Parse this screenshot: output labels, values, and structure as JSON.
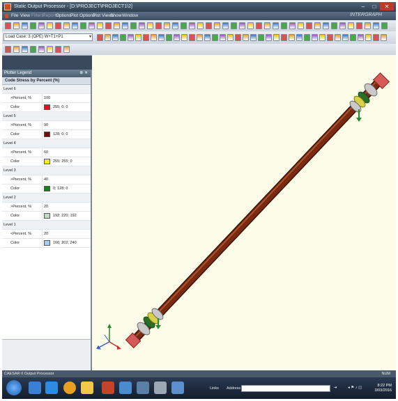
{
  "window": {
    "title": "Static Output Processor - [D:\\PROJECT\\PROJECT1\\2]",
    "brand": "INTERGRAPH",
    "controls": [
      "minimize",
      "maximize",
      "close"
    ]
  },
  "menu": [
    "File",
    "View",
    "Filters",
    "Reports",
    "Options",
    "Plot Options",
    "Plot Views",
    "Show",
    "Window"
  ],
  "menu_dim": [
    false,
    false,
    true,
    true,
    false,
    false,
    false,
    false,
    false
  ],
  "toolbar": {
    "load_case": "Load Case: 3 (OPE) W+T1+P1",
    "colors": [
      "#d9534f",
      "#e0a030",
      "#3b78c2",
      "#4aa84a",
      "#9b59b6",
      "#f1c40f"
    ]
  },
  "legend": {
    "header": "Plotter Legend",
    "subheader": "Code Stress by Percent (%)",
    "levels": [
      {
        "level": "Level 6",
        "cmp_label": ">Percent, %",
        "cmp_value": "100",
        "color_label": "Color",
        "color_value": "255; 0; 0",
        "hex": "#cc1f1f"
      },
      {
        "level": "Level 5",
        "cmp_label": ">Percent, %",
        "cmp_value": "90",
        "color_label": "Color",
        "color_value": "128; 0; 0",
        "hex": "#7a0a0a"
      },
      {
        "level": "Level 4",
        "cmp_label": ">Percent, %",
        "cmp_value": "60",
        "color_label": "Color",
        "color_value": "255; 255; 0",
        "hex": "#f3ee12"
      },
      {
        "level": "Level 3",
        "cmp_label": ">Percent, %",
        "cmp_value": "40",
        "color_label": "Color",
        "color_value": "0; 128; 0",
        "hex": "#1a7f1a"
      },
      {
        "level": "Level 2",
        "cmp_label": ">Percent, %",
        "cmp_value": "20",
        "color_label": "Color",
        "color_value": "192; 220; 192",
        "hex": "#c0dcc0"
      },
      {
        "level": "Level 1",
        "cmp_label": "<Percent, %",
        "cmp_value": "20",
        "color_label": "Color",
        "color_value": "166; 202; 240",
        "hex": "#a6caf0"
      }
    ]
  },
  "model": {
    "pipe_color": "#7a2a10",
    "flange_color": "#c9c9c9"
  },
  "status": {
    "left": "CAESAR II Output Processor",
    "right": "NUM"
  },
  "taskbar": {
    "links_label": "Links",
    "address_label": "Address",
    "time": "8:22 PM",
    "date": "3/03/2016"
  }
}
